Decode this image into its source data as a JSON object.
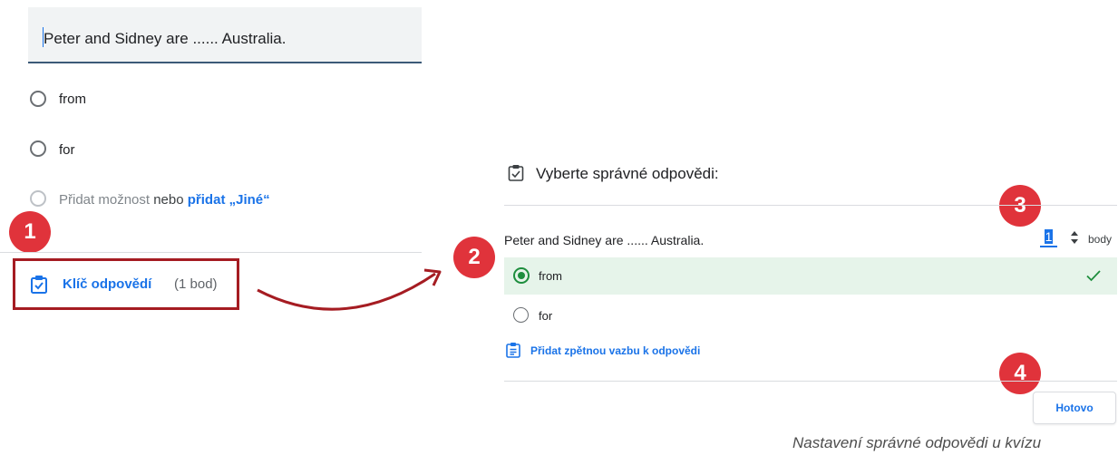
{
  "editor": {
    "question": "Peter and Sidney are ...... Australia.",
    "options": [
      {
        "label": "from"
      },
      {
        "label": "for"
      }
    ],
    "add_option": {
      "gray_label": "Přidat možnost",
      "or_text": "nebo",
      "add_other_label": "přidat „Jiné“"
    },
    "answer_key": {
      "label": "Klíč odpovědí",
      "points": "(1 bod)"
    }
  },
  "answer_panel": {
    "title": "Vyberte správné odpovědi:",
    "question": "Peter and Sidney are ...... Australia.",
    "points_value": "1",
    "points_unit": "body",
    "options": [
      {
        "label": "from",
        "correct": true
      },
      {
        "label": "for",
        "correct": false
      }
    ],
    "feedback_label": "Přidat zpětnou vazbu k odpovědi",
    "done_label": "Hotovo"
  },
  "badges": [
    "1",
    "2",
    "3",
    "4"
  ],
  "caption": "Nastavení správné odpovědi u kvízu",
  "colors": {
    "accent_blue": "#1a73e8",
    "correct_green": "#1e8e3e",
    "correct_bg": "#e6f4ea",
    "badge_red": "#e0333b",
    "highlight_frame": "#a51c22"
  }
}
